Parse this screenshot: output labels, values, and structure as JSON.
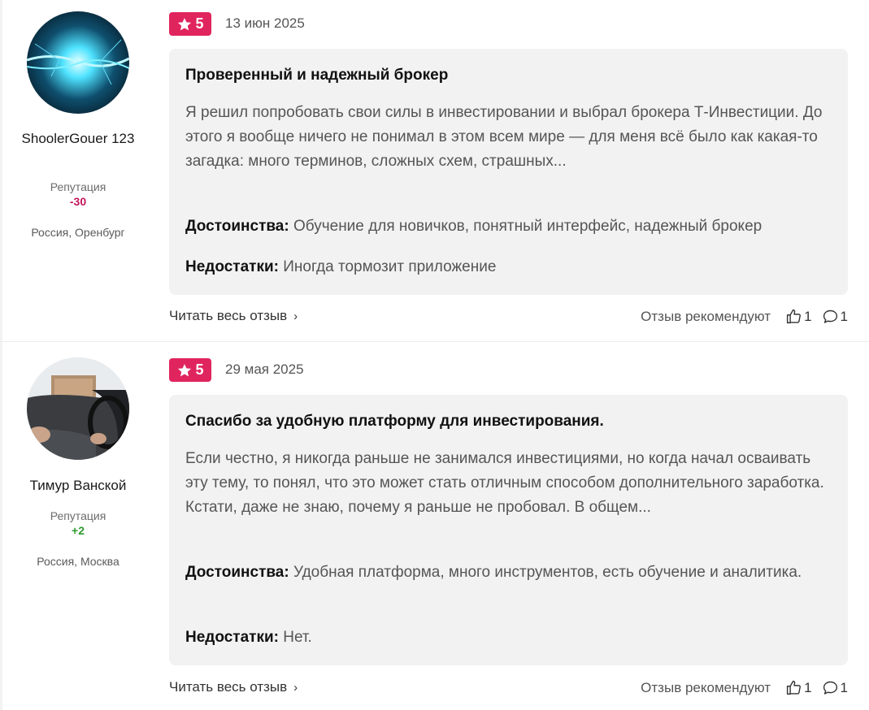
{
  "reviews": [
    {
      "user": {
        "name": "ShoolerGouer 123",
        "reputation_label": "Репутация",
        "reputation": "-30",
        "location": "Россия, Оренбург"
      },
      "rating": "5",
      "date": "13 июн 2025",
      "title": "Проверенный и надежный брокер",
      "body": "Я решил попробовать свои силы в инвестировании и выбрал брокера Т-Инвестиции. До этого я вообще ничего не понимал в этом всем мире — для меня всё было как какая-то загадка: много терминов, сложных схем, страшных...",
      "pros_label": "Достоинства:",
      "pros": "Обучение для новичков, понятный интерфейс, надежный брокер",
      "cons_label": "Недостатки:",
      "cons": "Иногда тормозит приложение",
      "read_more": "Читать весь отзыв",
      "recommend_label": "Отзыв рекомендуют",
      "likes": "1",
      "comments": "1"
    },
    {
      "user": {
        "name": "Тимур Ванской",
        "reputation_label": "Репутация",
        "reputation": "+2",
        "location": "Россия, Москва"
      },
      "rating": "5",
      "date": "29 мая 2025",
      "title": "Спасибо за удобную платформу для инвестирования.",
      "body": "Если честно, я никогда раньше не занимался инвестициями, но когда начал осваивать эту тему, то понял, что это может стать отличным способом дополнительного заработка. Кстати, даже не знаю, почему я раньше не пробовал. В общем...",
      "pros_label": "Достоинства:",
      "pros": "Удобная платформа, много инструментов, есть обучение и аналитика.",
      "cons_label": "Недостатки:",
      "cons": "Нет.",
      "read_more": "Читать весь отзыв",
      "recommend_label": "Отзыв рекомендуют",
      "likes": "1",
      "comments": "1"
    }
  ],
  "colors": {
    "badge": "#e0245e",
    "rep_negative": "#c2185b",
    "rep_positive": "#2e9b2e",
    "card": "#f2f2f2"
  },
  "icons": [
    "star-icon",
    "chevron-right-icon",
    "thumbs-up-icon",
    "comment-icon"
  ]
}
